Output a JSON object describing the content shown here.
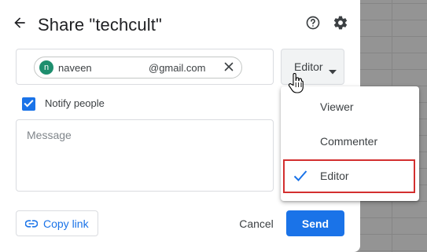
{
  "dialog": {
    "title": "Share \"techcult\"",
    "icons": {
      "back": "arrow-left-icon",
      "help": "help-circle-icon",
      "settings": "gear-icon"
    }
  },
  "recipient": {
    "avatar_initial": "n",
    "name": "naveen",
    "domain": "@gmail.com",
    "remove_icon": "close-icon"
  },
  "role_button": {
    "label": "Editor",
    "caret_icon": "caret-down-icon"
  },
  "role_menu": {
    "items": [
      {
        "label": "Viewer",
        "checked": false
      },
      {
        "label": "Commenter",
        "checked": false
      },
      {
        "label": "Editor",
        "checked": true
      }
    ],
    "highlight_color": "#d32f2f"
  },
  "notify": {
    "label": "Notify people",
    "checked": true
  },
  "message": {
    "placeholder": "Message"
  },
  "footer": {
    "copy_link_label": "Copy link",
    "cancel_label": "Cancel",
    "send_label": "Send"
  },
  "colors": {
    "accent": "#1a73e8",
    "avatar": "#1e8e6e",
    "highlight": "#d32f2f"
  }
}
